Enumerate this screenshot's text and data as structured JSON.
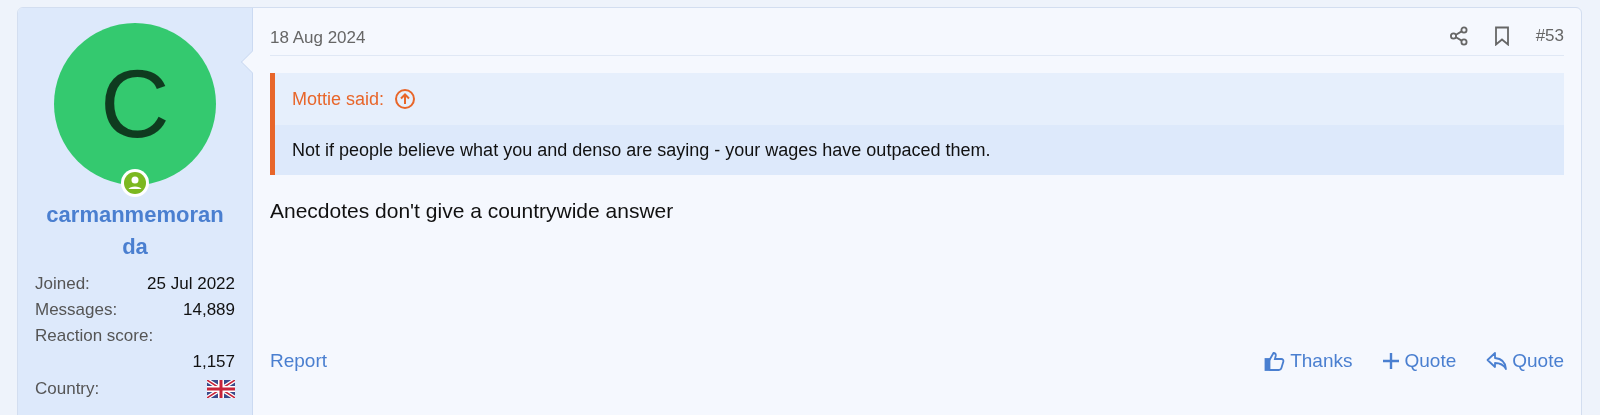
{
  "author": {
    "avatar_letter": "C",
    "online": true,
    "username": "carmanmemoranda",
    "stats": [
      {
        "label": "Joined:",
        "value": "25 Jul 2022",
        "kind": "inline"
      },
      {
        "label": "Messages:",
        "value": "14,889",
        "kind": "inline"
      },
      {
        "label": "Reaction score:",
        "value": "1,157",
        "kind": "stacked"
      },
      {
        "label": "Country:",
        "kind": "flag"
      }
    ]
  },
  "post": {
    "date": "18 Aug 2024",
    "number": "#53",
    "quote": {
      "author": "Mottie said:",
      "text": "Not if people believe what you and denso are saying - your wages have outpaced them."
    },
    "body": "Anecdotes don't give a countrywide answer",
    "report": "Report",
    "actions": [
      {
        "kind": "thanks",
        "label": "Thanks"
      },
      {
        "kind": "multiquote",
        "label": "Quote"
      },
      {
        "kind": "reply",
        "label": "Quote"
      }
    ]
  }
}
